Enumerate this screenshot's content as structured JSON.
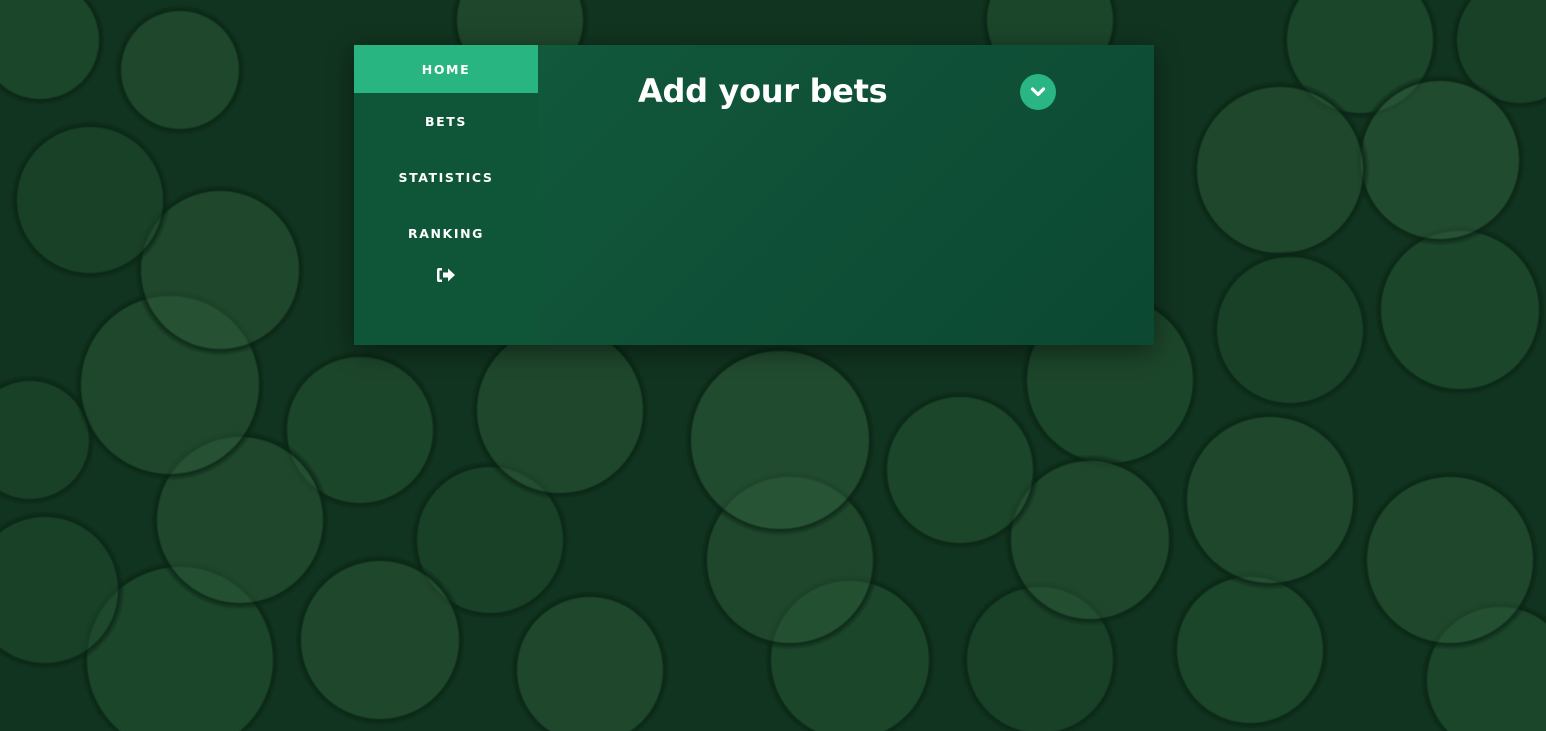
{
  "sidebar": {
    "items": [
      {
        "label": "HOME",
        "active": true
      },
      {
        "label": "BETS",
        "active": false
      },
      {
        "label": "STATISTICS",
        "active": false
      },
      {
        "label": "RANKING",
        "active": false
      }
    ],
    "logout_icon": "sign-out-icon"
  },
  "main": {
    "title": "Add your bets",
    "toggle_icon": "chevron-down-icon"
  },
  "colors": {
    "accent": "#28b581",
    "sidebar_bg": "#0f5538",
    "content_bg": "#11583c",
    "page_bg": "#163a24"
  }
}
